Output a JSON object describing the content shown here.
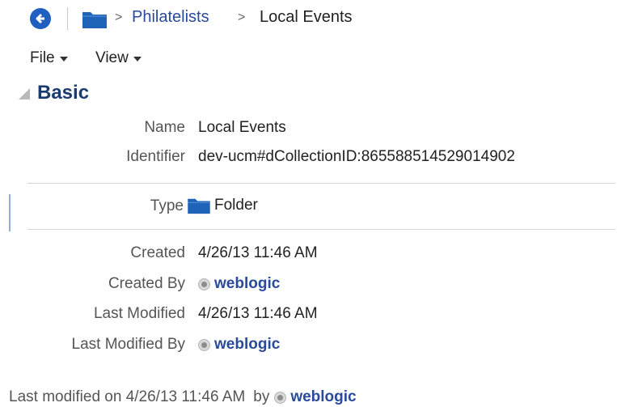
{
  "breadcrumb": {
    "separator": ">",
    "items": [
      "Philatelists"
    ],
    "current": "Local Events"
  },
  "menus": {
    "file": "File",
    "view": "View"
  },
  "section": {
    "title": "Basic"
  },
  "fields": {
    "name": {
      "label": "Name",
      "value": "Local Events"
    },
    "identifier": {
      "label": "Identifier",
      "value": "dev-ucm#dCollectionID:865588514529014902"
    },
    "type": {
      "label": "Type",
      "value": "Folder"
    },
    "created": {
      "label": "Created",
      "value": "4/26/13 11:46 AM"
    },
    "created_by": {
      "label": "Created By",
      "value": "weblogic"
    },
    "last_modified": {
      "label": "Last Modified",
      "value": "4/26/13 11:46 AM"
    },
    "last_modified_by": {
      "label": "Last Modified By",
      "value": "weblogic"
    }
  },
  "footer": {
    "prefix": "Last modified on 4/26/13 11:46 AM",
    "by": "by",
    "user": "weblogic"
  },
  "colors": {
    "accent": "#1f5fbf",
    "link": "#2a4a9b",
    "folder": "#1e63b8"
  }
}
